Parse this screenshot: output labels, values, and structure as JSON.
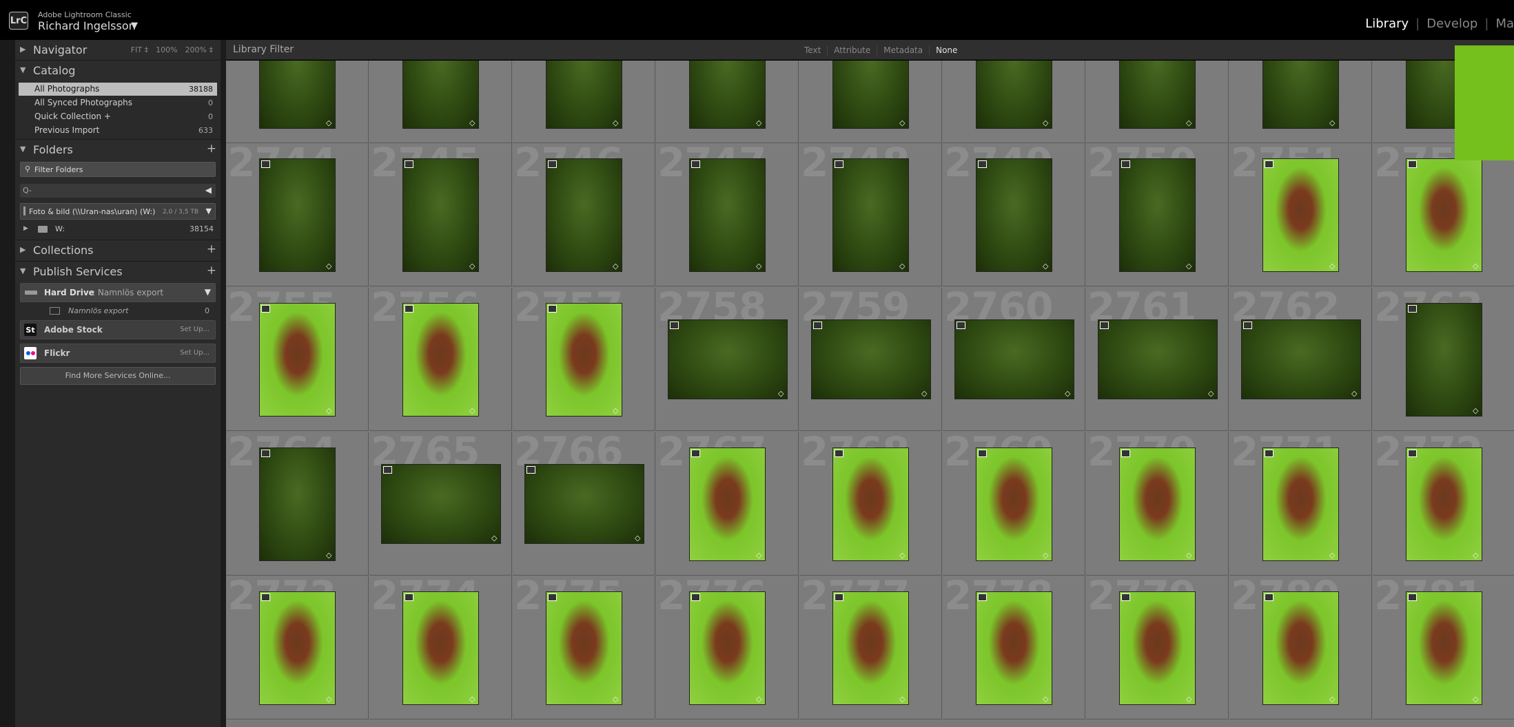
{
  "app": {
    "logo": "LrC",
    "name": "Adobe Lightroom Classic",
    "user": "Richard Ingelsson",
    "user_caret": "▼"
  },
  "modules": {
    "library": "Library",
    "develop": "Develop",
    "map_partial": "Ma",
    "separator": "|"
  },
  "navigator": {
    "title": "Navigator",
    "fit": "FIT ‡",
    "zoom100": "100%",
    "zoom200": "200% ‡"
  },
  "catalog": {
    "title": "Catalog",
    "items": [
      {
        "label": "All Photographs",
        "count": "38188"
      },
      {
        "label": "All Synced Photographs",
        "count": "0"
      },
      {
        "label": "Quick Collection +",
        "count": "0"
      },
      {
        "label": "Previous Import",
        "count": "633"
      }
    ]
  },
  "folders": {
    "title": "Folders",
    "add": "+",
    "filter_placeholder": "Filter Folders",
    "search_prefix": "Q-",
    "volume_name": "Foto & bild (\\\\Uran-nas\\uran) (W:)",
    "volume_size": "2,0 / 3,5 TB",
    "folder_name": "W:",
    "folder_count": "38154"
  },
  "collections": {
    "title": "Collections",
    "add": "+"
  },
  "publish": {
    "title": "Publish Services",
    "add": "+",
    "hard_drive_label": "Hard Drive",
    "hard_drive_sub": ": Namnlös export",
    "export_item": "Namnlös export",
    "export_count": "0",
    "adobe_stock_icon": "St",
    "adobe_stock": "Adobe Stock",
    "flickr": "Flickr",
    "setup": "Set Up...",
    "find_more": "Find More Services Online..."
  },
  "filter_bar": {
    "title": "Library Filter",
    "text": "Text",
    "attribute": "Attribute",
    "metadata": "Metadata",
    "none": "None"
  },
  "grid": {
    "rows": [
      [
        "",
        "",
        "",
        "",
        "",
        "",
        "",
        "",
        ""
      ],
      [
        "2744",
        "2745",
        "2746",
        "2747",
        "2748",
        "2749",
        "2750",
        "2751",
        "2752"
      ],
      [
        "2755",
        "2756",
        "2757",
        "2758",
        "2759",
        "2760",
        "2761",
        "2762",
        "2763"
      ],
      [
        "2764",
        "2765",
        "2766",
        "2767",
        "2768",
        "2769",
        "2770",
        "2771",
        "2772"
      ],
      [
        "2773",
        "2774",
        "2775",
        "2776",
        "2777",
        "2778",
        "2779",
        "2780",
        "2781"
      ]
    ]
  },
  "colors": {
    "tint_dark": "#2f4a12",
    "tint_light": "#7cc52a",
    "accent_green": "#76c01d"
  }
}
